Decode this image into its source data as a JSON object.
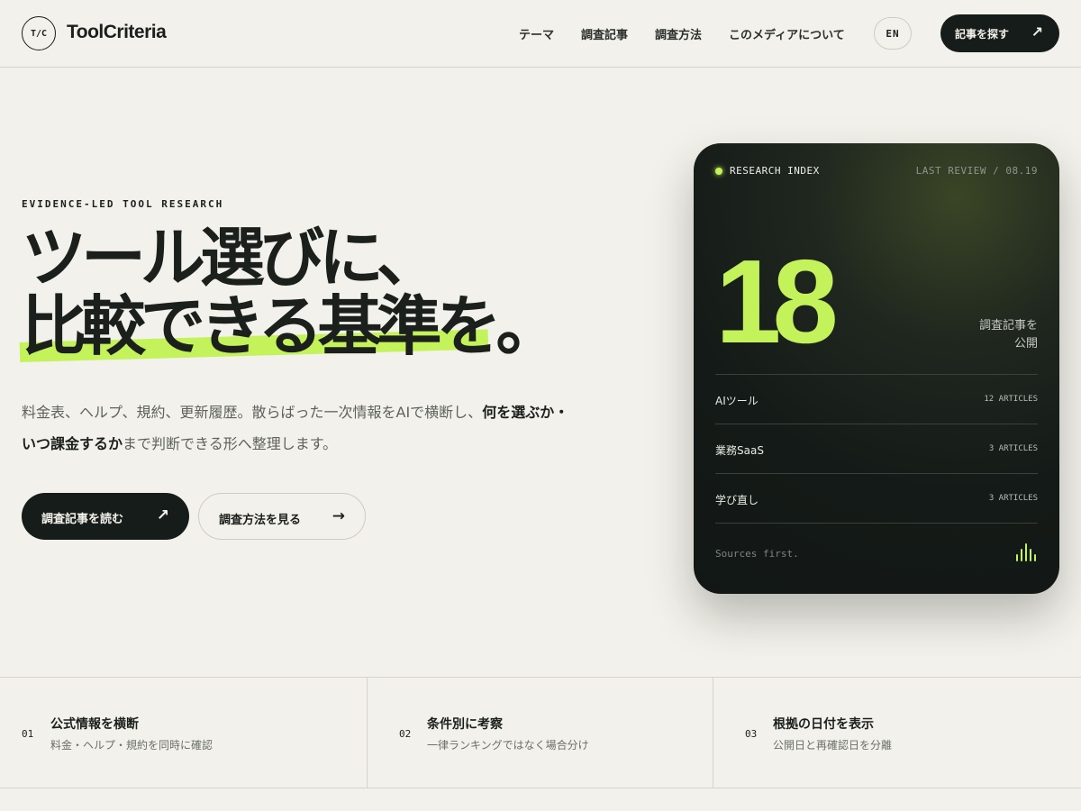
{
  "brand": {
    "mark": "T/C",
    "name": "ToolCriteria"
  },
  "nav": {
    "items": [
      {
        "label": "テーマ"
      },
      {
        "label": "調査記事"
      },
      {
        "label": "調査方法"
      },
      {
        "label": "このメディアについて"
      }
    ],
    "lang_label": "EN",
    "cta_label": "記事を探す",
    "cta_arrow": "↗"
  },
  "hero": {
    "eyebrow": "EVIDENCE-LED TOOL RESEARCH",
    "headline_line1": "ツール選びに、",
    "headline_line2": "比較できる基準を。",
    "lead_prefix": "料金表、ヘルプ、規約、更新履歴。散らばった一次情報をAIで横断し、",
    "lead_bold1": "何を選ぶか・",
    "lead_bold2": "いつ課金するか",
    "lead_suffix": "まで判断できる形へ整理します。",
    "primary_button": "調査記事を読む",
    "primary_arrow": "↗",
    "secondary_button": "調査方法を見る",
    "secondary_arrow": "→"
  },
  "card": {
    "label": "RESEARCH INDEX",
    "last_review": "LAST REVIEW / 08.19",
    "count": "18",
    "caption_line1": "調査記事を",
    "caption_line2": "公開",
    "rows": [
      {
        "name": "AIツール",
        "count": "12 ARTICLES"
      },
      {
        "name": "業務SaaS",
        "count": "3 ARTICLES"
      },
      {
        "name": "学び直し",
        "count": "3 ARTICLES"
      }
    ],
    "footer": "Sources first.",
    "accent_color": "#c4f25a",
    "footer_icon": "waveform-icon"
  },
  "features": [
    {
      "num": "01",
      "title": "公式情報を横断",
      "sub": "料金・ヘルプ・規約を同時に確認"
    },
    {
      "num": "02",
      "title": "条件別に考察",
      "sub": "一律ランキングではなく場合分け"
    },
    {
      "num": "03",
      "title": "根拠の日付を表示",
      "sub": "公開日と再確認日を分離"
    }
  ]
}
